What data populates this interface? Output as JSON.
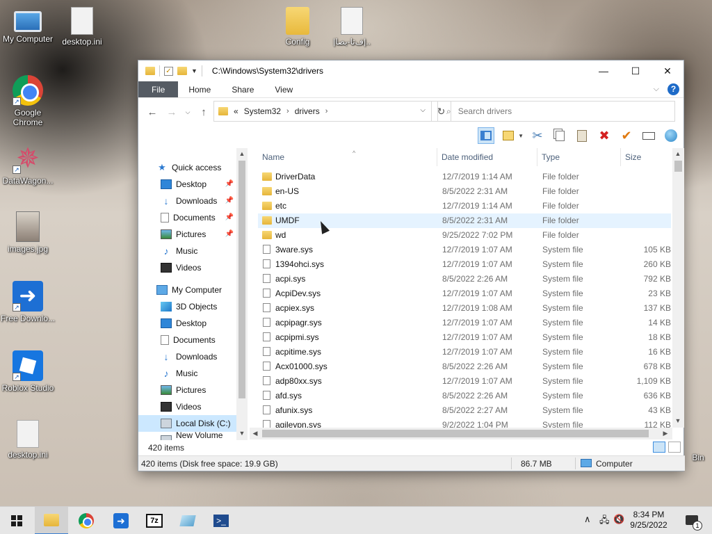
{
  "desktop": {
    "icons": [
      {
        "label": "My Computer",
        "icon": "computer-icon"
      },
      {
        "label": "desktop.ini",
        "icon": "settings-file-icon"
      },
      {
        "label": "Config",
        "icon": "folder-icon"
      },
      {
        "label": "|ف‌تا-بصا|..",
        "icon": "text-file-icon"
      },
      {
        "label": "Google Chrome",
        "icon": "chrome-icon"
      },
      {
        "label": "DataWagon...",
        "icon": "datawagon-icon"
      },
      {
        "label": "images.jpg",
        "icon": "image-file-icon"
      },
      {
        "label": "Free Downlo...",
        "icon": "free-download-manager-icon"
      },
      {
        "label": "Roblox Studio",
        "icon": "roblox-studio-icon"
      },
      {
        "label": "desktop.ini",
        "icon": "settings-file-icon"
      },
      {
        "label": "Bin",
        "icon": "recycle-bin-icon"
      }
    ]
  },
  "window": {
    "title": "C:\\Windows\\System32\\drivers",
    "tabs": [
      "File",
      "Home",
      "Share",
      "View"
    ],
    "address": {
      "overflow": "«",
      "crumbs": [
        "System32",
        "drivers"
      ]
    },
    "search_placeholder": "Search drivers",
    "navigation": [
      {
        "label": "Quick access",
        "icon": "star-icon",
        "pinned": false
      },
      {
        "label": "Desktop",
        "icon": "desktop-icon",
        "pinned": true
      },
      {
        "label": "Downloads",
        "icon": "download-icon",
        "pinned": true
      },
      {
        "label": "Documents",
        "icon": "documents-icon",
        "pinned": true
      },
      {
        "label": "Pictures",
        "icon": "pictures-icon",
        "pinned": true
      },
      {
        "label": "Music",
        "icon": "music-icon",
        "pinned": false
      },
      {
        "label": "Videos",
        "icon": "videos-icon",
        "pinned": false
      },
      {
        "label": "My Computer",
        "icon": "computer-icon",
        "pinned": false
      },
      {
        "label": "3D Objects",
        "icon": "3d-objects-icon",
        "pinned": false
      },
      {
        "label": "Desktop",
        "icon": "desktop-icon",
        "pinned": false
      },
      {
        "label": "Documents",
        "icon": "documents-icon",
        "pinned": false
      },
      {
        "label": "Downloads",
        "icon": "download-icon",
        "pinned": false
      },
      {
        "label": "Music",
        "icon": "music-icon",
        "pinned": false
      },
      {
        "label": "Pictures",
        "icon": "pictures-icon",
        "pinned": false
      },
      {
        "label": "Videos",
        "icon": "videos-icon",
        "pinned": false
      },
      {
        "label": "Local Disk (C:)",
        "icon": "drive-icon",
        "pinned": false,
        "selected": true
      },
      {
        "label": "New Volume (E:)",
        "icon": "drive-icon",
        "pinned": false
      }
    ],
    "columns": [
      "Name",
      "Date modified",
      "Type",
      "Size"
    ],
    "files": [
      {
        "name": "DriverData",
        "date": "12/7/2019 1:14 AM",
        "type": "File folder",
        "size": "",
        "kind": "folder"
      },
      {
        "name": "en-US",
        "date": "8/5/2022 2:31 AM",
        "type": "File folder",
        "size": "",
        "kind": "folder"
      },
      {
        "name": "etc",
        "date": "12/7/2019 1:14 AM",
        "type": "File folder",
        "size": "",
        "kind": "folder"
      },
      {
        "name": "UMDF",
        "date": "8/5/2022 2:31 AM",
        "type": "File folder",
        "size": "",
        "kind": "folder",
        "hover": true
      },
      {
        "name": "wd",
        "date": "9/25/2022 7:02 PM",
        "type": "File folder",
        "size": "",
        "kind": "folder"
      },
      {
        "name": "3ware.sys",
        "date": "12/7/2019 1:07 AM",
        "type": "System file",
        "size": "105 KB",
        "kind": "sys"
      },
      {
        "name": "1394ohci.sys",
        "date": "12/7/2019 1:07 AM",
        "type": "System file",
        "size": "260 KB",
        "kind": "sys"
      },
      {
        "name": "acpi.sys",
        "date": "8/5/2022 2:26 AM",
        "type": "System file",
        "size": "792 KB",
        "kind": "sys"
      },
      {
        "name": "AcpiDev.sys",
        "date": "12/7/2019 1:07 AM",
        "type": "System file",
        "size": "23 KB",
        "kind": "sys"
      },
      {
        "name": "acpiex.sys",
        "date": "12/7/2019 1:08 AM",
        "type": "System file",
        "size": "137 KB",
        "kind": "sys"
      },
      {
        "name": "acpipagr.sys",
        "date": "12/7/2019 1:07 AM",
        "type": "System file",
        "size": "14 KB",
        "kind": "sys"
      },
      {
        "name": "acpipmi.sys",
        "date": "12/7/2019 1:07 AM",
        "type": "System file",
        "size": "18 KB",
        "kind": "sys"
      },
      {
        "name": "acpitime.sys",
        "date": "12/7/2019 1:07 AM",
        "type": "System file",
        "size": "16 KB",
        "kind": "sys"
      },
      {
        "name": "Acx01000.sys",
        "date": "8/5/2022 2:26 AM",
        "type": "System file",
        "size": "678 KB",
        "kind": "sys"
      },
      {
        "name": "adp80xx.sys",
        "date": "12/7/2019 1:07 AM",
        "type": "System file",
        "size": "1,109 KB",
        "kind": "sys"
      },
      {
        "name": "afd.sys",
        "date": "8/5/2022 2:26 AM",
        "type": "System file",
        "size": "636 KB",
        "kind": "sys"
      },
      {
        "name": "afunix.sys",
        "date": "8/5/2022 2:27 AM",
        "type": "System file",
        "size": "43 KB",
        "kind": "sys"
      },
      {
        "name": "agilevpn.sys",
        "date": "9/2/2022 1:04 PM",
        "type": "System file",
        "size": "112 KB",
        "kind": "sys"
      }
    ],
    "status": {
      "item_count": "420 items",
      "details": "420 items (Disk free space: 19.9 GB)",
      "size": "86.7 MB",
      "location": "Computer"
    }
  },
  "taskbar": {
    "apps": [
      "start-icon",
      "file-explorer-icon",
      "chrome-icon",
      "free-download-manager-icon",
      "7zip-icon",
      "notepad-icon",
      "powershell-icon"
    ],
    "time": "8:34 PM",
    "date": "9/25/2022",
    "notification_count": "1"
  },
  "colors": {
    "accent": "#0078d7",
    "file_tab": "#555b63",
    "selection": "#cce8ff",
    "hover": "#e5f3ff"
  }
}
